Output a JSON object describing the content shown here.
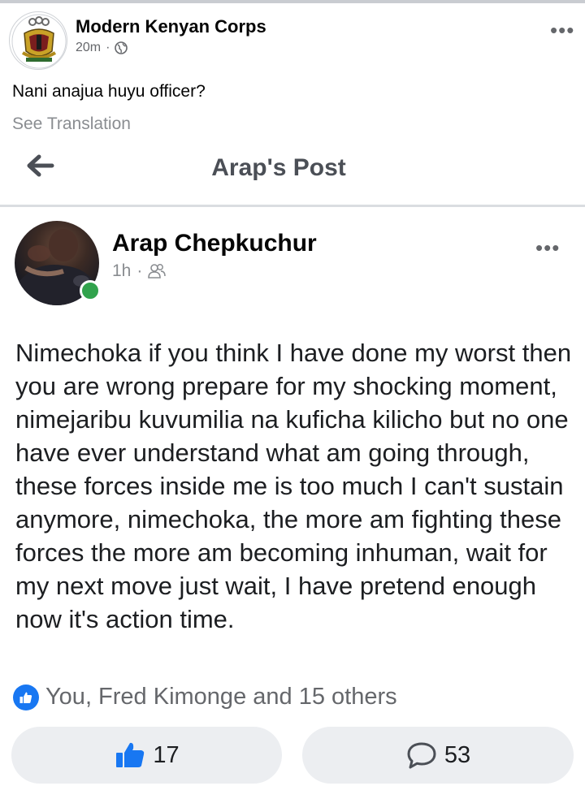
{
  "outer_post": {
    "page_name": "Modern Kenyan Corps",
    "timestamp": "20m",
    "separator": "·",
    "caption": "Nani anajua huyu officer?",
    "see_translation": "See Translation"
  },
  "shared_header": {
    "title": "Arap's Post"
  },
  "shared_post": {
    "author": "Arap Chepkuchur",
    "timestamp": "1h",
    "separator": "·",
    "body": "Nimechoka if you think I have done my worst then you are wrong prepare for my shocking moment, nimejaribu kuvumilia na kuficha kilicho but no one have ever understand what am going through, these forces inside me is too much I can't sustain anymore, nimechoka, the more am fighting these forces the more am becoming inhuman, wait for my next move just wait, I have pretend enough now it's action time."
  },
  "reactions": {
    "summary": "You, Fred Kimonge and 15 others"
  },
  "actions": {
    "like_count": "17",
    "comment_count": "53"
  },
  "icons": {
    "more": "more-dots-icon",
    "globe": "globe-icon",
    "friends": "friends-icon",
    "back": "back-arrow-icon",
    "like": "thumbs-up-icon",
    "comment": "comment-bubble-icon"
  },
  "colors": {
    "brand_blue": "#1877f2",
    "online_green": "#31a24c",
    "pill_bg": "#eceef1",
    "meta_gray": "#65676b"
  }
}
